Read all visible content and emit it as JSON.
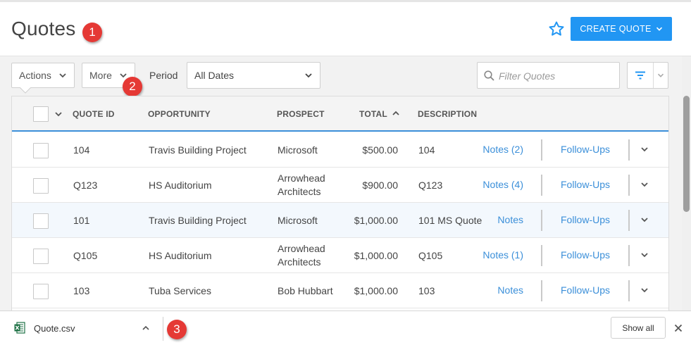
{
  "header": {
    "title": "Quotes",
    "create_label": "CREATE QUOTE",
    "accent": "#2196f3"
  },
  "badges": [
    "1",
    "2",
    "3"
  ],
  "toolbar": {
    "actions_label": "Actions",
    "more_label": "More",
    "period_label": "Period",
    "period_value": "All Dates",
    "filter_placeholder": "Filter Quotes"
  },
  "table": {
    "columns": [
      "QUOTE ID",
      "OPPORTUNITY",
      "PROSPECT",
      "TOTAL",
      "DESCRIPTION"
    ],
    "sort_column": "TOTAL",
    "sort_direction": "ascending",
    "rows": [
      {
        "id": "104",
        "opportunity": "Travis Building Project",
        "prospect": "Microsoft",
        "total": "$500.00",
        "description": "104",
        "notes": "Notes (2)",
        "followups": "Follow-Ups"
      },
      {
        "id": "Q123",
        "opportunity": "HS Auditorium",
        "prospect": "Arrowhead Architects",
        "total": "$900.00",
        "description": "Q123",
        "notes": "Notes (4)",
        "followups": "Follow-Ups"
      },
      {
        "id": "101",
        "opportunity": "Travis Building Project",
        "prospect": "Microsoft",
        "total": "$1,000.00",
        "description": "101 MS Quote",
        "notes": "Notes",
        "followups": "Follow-Ups"
      },
      {
        "id": "Q105",
        "opportunity": "HS Auditorium",
        "prospect": "Arrowhead Architects",
        "total": "$1,000.00",
        "description": "Q105",
        "notes": "Notes (1)",
        "followups": "Follow-Ups"
      },
      {
        "id": "103",
        "opportunity": "Tuba Services",
        "prospect": "Bob Hubbart",
        "total": "$1,000.00",
        "description": "103",
        "notes": "Notes",
        "followups": "Follow-Ups"
      }
    ]
  },
  "download_bar": {
    "file_name": "Quote.csv",
    "show_all_label": "Show all"
  }
}
